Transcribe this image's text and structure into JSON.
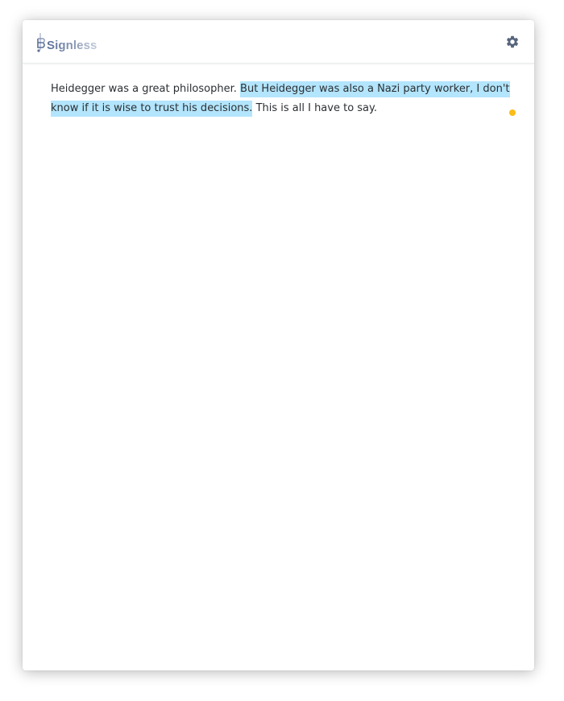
{
  "app": {
    "logo_text": "Signless"
  },
  "header": {
    "settings_icon": "gear-icon"
  },
  "document": {
    "text_before": "Heidegger was a great philosopher. ",
    "highlighted_text": "But Heidegger was also a Nazi party worker, I don't know if it is wise to trust his decisions.",
    "text_after": " This is all I have to say."
  },
  "colors": {
    "highlight": "#b3e5fc",
    "marker": "#fbbc16",
    "settings_icon": "#56657c"
  }
}
